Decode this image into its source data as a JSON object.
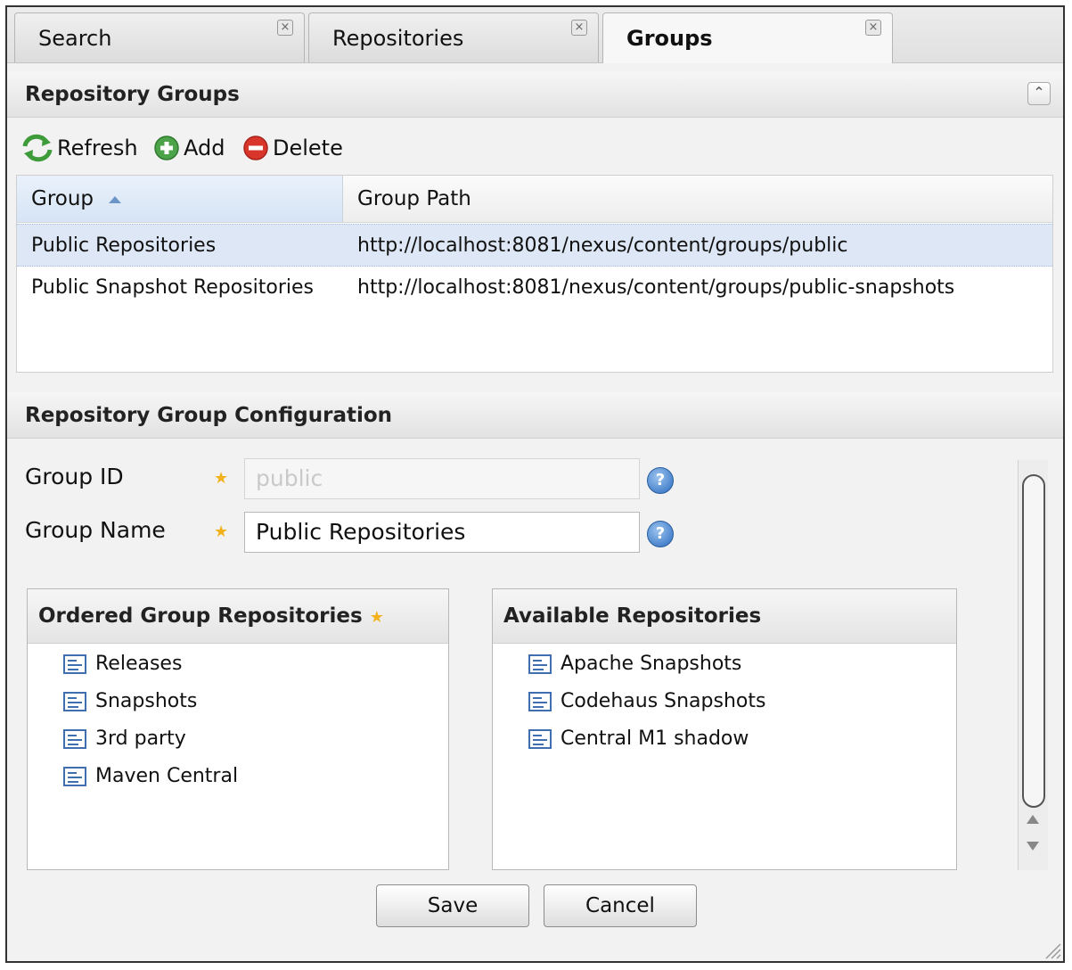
{
  "tabs": [
    {
      "label": "Search",
      "active": false
    },
    {
      "label": "Repositories",
      "active": false
    },
    {
      "label": "Groups",
      "active": true
    }
  ],
  "close_glyph": "×",
  "repo_groups": {
    "title": "Repository Groups",
    "collapse_glyph": "⌃",
    "toolbar": {
      "refresh_label": "Refresh",
      "add_label": "Add",
      "delete_label": "Delete"
    },
    "columns": {
      "group": "Group",
      "group_path": "Group Path"
    },
    "rows": [
      {
        "group": "Public Repositories",
        "path": "http://localhost:8081/nexus/content/groups/public",
        "selected": true
      },
      {
        "group": "Public Snapshot Repositories",
        "path": "http://localhost:8081/nexus/content/groups/public-snapshots",
        "selected": false
      }
    ]
  },
  "config": {
    "title": "Repository Group Configuration",
    "group_id_label": "Group ID",
    "group_id_value": "public",
    "group_name_label": "Group Name",
    "group_name_value": "Public Repositories",
    "required_glyph": "★",
    "help_glyph": "?",
    "ordered": {
      "title": "Ordered Group Repositories",
      "items": [
        "Releases",
        "Snapshots",
        "3rd party",
        "Maven Central"
      ]
    },
    "available": {
      "title": "Available Repositories",
      "items": [
        "Apache Snapshots",
        "Codehaus Snapshots",
        "Central M1 shadow"
      ]
    },
    "save_label": "Save",
    "cancel_label": "Cancel"
  },
  "colors": {
    "accent": "#3f6fae",
    "selected_row": "#dde7f5",
    "required_star": "#f3b21b",
    "add_green": "#4ca34a",
    "delete_red": "#d9362b"
  }
}
